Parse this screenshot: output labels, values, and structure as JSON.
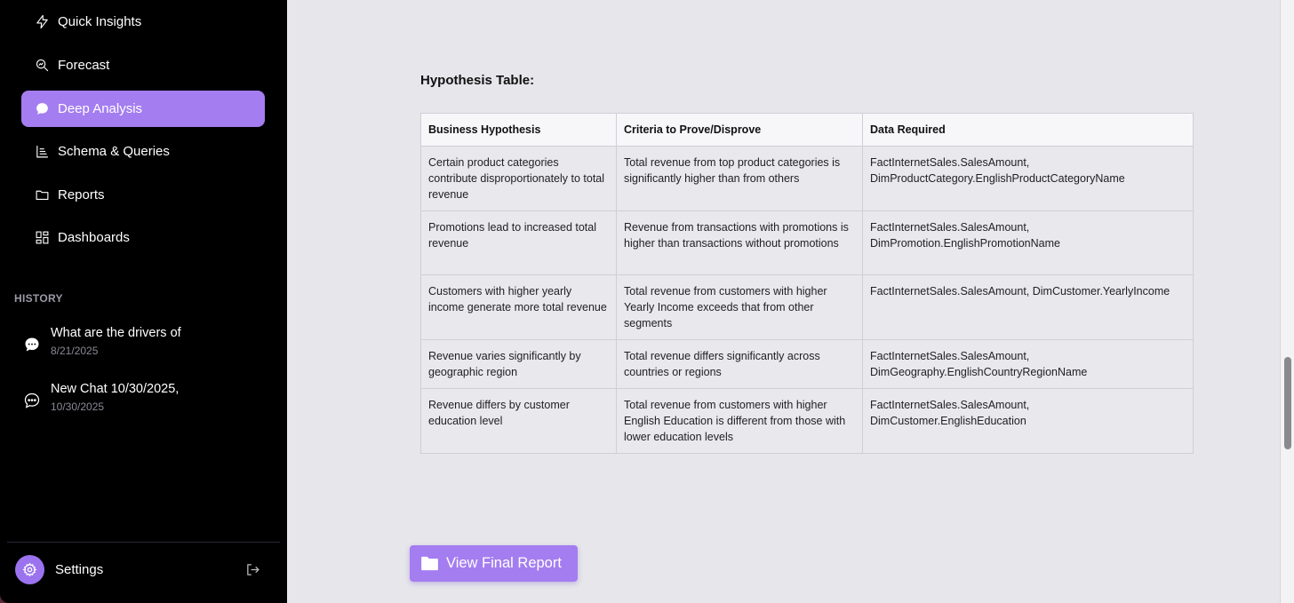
{
  "sidebar": {
    "nav": [
      {
        "label": "Quick Insights",
        "icon": "lightning-icon"
      },
      {
        "label": "Forecast",
        "icon": "magnify-chart-icon"
      },
      {
        "label": "Deep Analysis",
        "icon": "chat-bubble-icon",
        "active": true
      },
      {
        "label": "Schema & Queries",
        "icon": "schema-icon"
      },
      {
        "label": "Reports",
        "icon": "folder-icon"
      },
      {
        "label": "Dashboards",
        "icon": "grid-icon"
      }
    ],
    "history_heading": "HISTORY",
    "history": [
      {
        "title": "What are the drivers of",
        "date": "8/21/2025"
      },
      {
        "title": "New Chat 10/30/2025,",
        "date": "10/30/2025"
      }
    ],
    "settings_label": "Settings"
  },
  "main": {
    "section_title": "Hypothesis Table:",
    "table": {
      "headers": [
        "Business Hypothesis",
        "Criteria to Prove/Disprove",
        "Data Required"
      ],
      "rows": [
        [
          "Certain product categories contribute disproportionately to total revenue",
          "Total revenue from top product categories is significantly higher than from others",
          "FactInternetSales.SalesAmount, DimProductCategory.EnglishProductCategoryName"
        ],
        [
          "Promotions lead to increased total revenue",
          "Revenue from transactions with promotions is higher than transactions without promotions",
          "FactInternetSales.SalesAmount, DimPromotion.EnglishPromotionName"
        ],
        [
          "Customers with higher yearly income generate more total revenue",
          "Total revenue from customers with higher Yearly Income exceeds that from other segments",
          "FactInternetSales.SalesAmount, DimCustomer.YearlyIncome"
        ],
        [
          "Revenue varies significantly by geographic region",
          "Total revenue differs significantly across countries or regions",
          "FactInternetSales.SalesAmount, DimGeography.EnglishCountryRegionName"
        ],
        [
          "Revenue differs by customer education level",
          "Total revenue from customers with higher English Education is different from those with lower education levels",
          "FactInternetSales.SalesAmount, DimCustomer.EnglishEducation"
        ]
      ]
    },
    "report_button": "View Final Report"
  },
  "colors": {
    "accent": "#a47df0",
    "sidebar_bg": "#000000",
    "main_bg": "#e6e6eb"
  }
}
